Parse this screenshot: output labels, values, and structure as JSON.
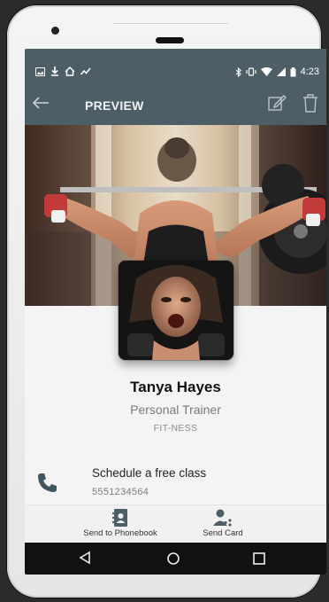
{
  "status_bar": {
    "time": "4:23",
    "left_icons": [
      "image-icon",
      "download-icon",
      "home-icon",
      "activity-icon"
    ],
    "right_icons": [
      "bluetooth-icon",
      "vibrate-icon",
      "wifi-icon",
      "signal-icon",
      "battery-icon"
    ]
  },
  "app_bar": {
    "title": "PREVIEW",
    "back_icon": "arrow-left-icon",
    "edit_icon": "edit-icon",
    "delete_icon": "trash-icon"
  },
  "profile": {
    "name": "Tanya Hayes",
    "role": "Personal Trainer",
    "company": "FIT-NESS"
  },
  "contact_row": {
    "icon": "phone-icon",
    "title": "Schedule a free class",
    "subtitle": "5551234564"
  },
  "actions": [
    {
      "label": "Send to Phonebook",
      "icon": "phonebook-icon"
    },
    {
      "label": "Send Card",
      "icon": "share-contact-icon"
    }
  ],
  "nav_bar": {
    "buttons": [
      "nav-back-icon",
      "nav-home-icon",
      "nav-recent-icon"
    ]
  },
  "colors": {
    "app_bar": "#4e5e67",
    "background": "#f4f4f4",
    "nav_bar": "#111111"
  }
}
